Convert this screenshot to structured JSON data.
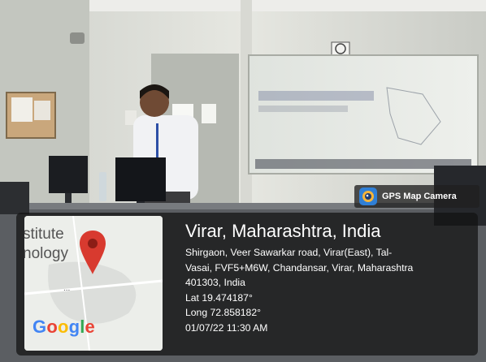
{
  "badge": {
    "label": "GPS Map Camera",
    "icon": "camera-lens-icon"
  },
  "map": {
    "fragment_top": "stitute",
    "fragment_bottom": "nology",
    "fragment_dots": "...",
    "logo": "Google",
    "pin_icon": "map-pin-icon",
    "pin_color": "#d83a2f"
  },
  "location": {
    "headline": "Virar, Maharashtra, India",
    "address_line_1": "Shirgaon, Veer Sawarkar road, Virar(East), Tal-",
    "address_line_2": "Vasai, FVF5+M6W, Chandansar, Virar, Maharashtra",
    "address_line_3": "401303, India",
    "latitude": "Lat 19.474187°",
    "longitude": "Long 72.858182°",
    "datetime": "01/07/22 11:30 AM"
  }
}
